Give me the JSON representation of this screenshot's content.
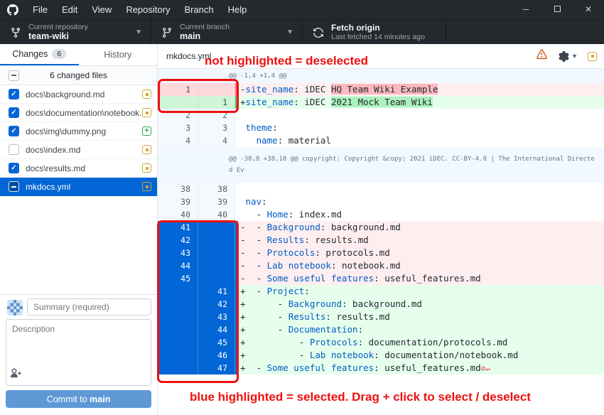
{
  "titlebar": {
    "menus": [
      "File",
      "Edit",
      "View",
      "Repository",
      "Branch",
      "Help"
    ],
    "window_controls": [
      "minimize",
      "maximize",
      "close"
    ]
  },
  "toolbar": {
    "repository": {
      "label": "Current repository",
      "value": "team-wiki"
    },
    "branch": {
      "label": "Current branch",
      "value": "main"
    },
    "fetch": {
      "title": "Fetch origin",
      "subtitle": "Last fetched 14 minutes ago"
    }
  },
  "sidebar": {
    "tabs": [
      {
        "label": "Changes",
        "badge": "6",
        "active": true
      },
      {
        "label": "History",
        "active": false
      }
    ],
    "files_header": {
      "label": "6 changed files",
      "checkbox": "partial"
    },
    "files": [
      {
        "name": "docs\\background.md",
        "checked": "checked",
        "status": "modified",
        "selected": false
      },
      {
        "name": "docs\\documentation\\notebook.md",
        "checked": "checked",
        "status": "modified",
        "selected": false
      },
      {
        "name": "docs\\img\\dummy.png",
        "checked": "checked",
        "status": "added",
        "selected": false
      },
      {
        "name": "docs\\index.md",
        "checked": "empty",
        "status": "modified",
        "selected": false
      },
      {
        "name": "docs\\results.md",
        "checked": "checked",
        "status": "modified",
        "selected": false
      },
      {
        "name": "mkdocs.yml",
        "checked": "partial",
        "status": "modified",
        "selected": true
      }
    ],
    "commit": {
      "summary_placeholder": "Summary (required)",
      "description_placeholder": "Description",
      "button_label": "Commit to ",
      "button_branch": "main"
    }
  },
  "diff": {
    "file_name": "mkdocs.yml",
    "rows": [
      {
        "k": "hunk",
        "text": "@@ -1,4 +1,4 @@"
      },
      {
        "k": "del",
        "old": "1",
        "new": "",
        "sel": false,
        "segs": [
          [
            "-",
            "p"
          ],
          [
            "site_name",
            "key"
          ],
          [
            ": iDEC ",
            "p"
          ],
          [
            "HQ Team Wiki Example",
            "hd"
          ]
        ]
      },
      {
        "k": "add",
        "old": "",
        "new": "1",
        "sel": false,
        "segs": [
          [
            "+",
            "p"
          ],
          [
            "site_name",
            "key"
          ],
          [
            ": iDEC ",
            "p"
          ],
          [
            "2021 Mock Team Wiki",
            "ha"
          ]
        ]
      },
      {
        "k": "ctx",
        "old": "2",
        "new": "2",
        "segs": [
          [
            " ",
            "p"
          ]
        ]
      },
      {
        "k": "ctx",
        "old": "3",
        "new": "3",
        "segs": [
          [
            " ",
            "p"
          ],
          [
            "theme",
            "key"
          ],
          [
            ":",
            "p"
          ]
        ]
      },
      {
        "k": "ctx",
        "old": "4",
        "new": "4",
        "segs": [
          [
            "   ",
            "p"
          ],
          [
            "name",
            "key"
          ],
          [
            ": material",
            "p"
          ]
        ]
      },
      {
        "k": "hunk",
        "tall": true,
        "text": "@@ -38,8 +38,10 @@ copyright: Copyright &copy; 2021 iDEC. CC-BY-4.0 | The International Directed Ev"
      },
      {
        "k": "ctx",
        "old": "38",
        "new": "38",
        "segs": [
          [
            " ",
            "p"
          ]
        ]
      },
      {
        "k": "ctx",
        "old": "39",
        "new": "39",
        "segs": [
          [
            " ",
            "p"
          ],
          [
            "nav",
            "key"
          ],
          [
            ":",
            "p"
          ]
        ]
      },
      {
        "k": "ctx",
        "old": "40",
        "new": "40",
        "segs": [
          [
            "   - ",
            "p"
          ],
          [
            "Home",
            "key"
          ],
          [
            ": index.md",
            "p"
          ]
        ]
      },
      {
        "k": "del",
        "old": "41",
        "new": "",
        "sel": true,
        "segs": [
          [
            "-  - ",
            "p"
          ],
          [
            "Background",
            "key"
          ],
          [
            ": background.md",
            "p"
          ]
        ]
      },
      {
        "k": "del",
        "old": "42",
        "new": "",
        "sel": true,
        "segs": [
          [
            "-  - ",
            "p"
          ],
          [
            "Results",
            "key"
          ],
          [
            ": results.md",
            "p"
          ]
        ]
      },
      {
        "k": "del",
        "old": "43",
        "new": "",
        "sel": true,
        "segs": [
          [
            "-  - ",
            "p"
          ],
          [
            "Protocols",
            "key"
          ],
          [
            ": protocols.md",
            "p"
          ]
        ]
      },
      {
        "k": "del",
        "old": "44",
        "new": "",
        "sel": true,
        "segs": [
          [
            "-  - ",
            "p"
          ],
          [
            "Lab notebook",
            "key"
          ],
          [
            ": notebook.md",
            "p"
          ]
        ]
      },
      {
        "k": "del",
        "old": "45",
        "new": "",
        "sel": true,
        "segs": [
          [
            "-  - ",
            "p"
          ],
          [
            "Some useful features",
            "key"
          ],
          [
            ": useful_features.md",
            "p"
          ]
        ]
      },
      {
        "k": "add",
        "old": "",
        "new": "41",
        "sel": true,
        "segs": [
          [
            "+  - ",
            "p"
          ],
          [
            "Project",
            "key"
          ],
          [
            ":",
            "p"
          ]
        ]
      },
      {
        "k": "add",
        "old": "",
        "new": "42",
        "sel": true,
        "segs": [
          [
            "+      - ",
            "p"
          ],
          [
            "Background",
            "key"
          ],
          [
            ": background.md",
            "p"
          ]
        ]
      },
      {
        "k": "add",
        "old": "",
        "new": "43",
        "sel": true,
        "segs": [
          [
            "+      - ",
            "p"
          ],
          [
            "Results",
            "key"
          ],
          [
            ": results.md",
            "p"
          ]
        ]
      },
      {
        "k": "add",
        "old": "",
        "new": "44",
        "sel": true,
        "segs": [
          [
            "+      - ",
            "p"
          ],
          [
            "Documentation",
            "key"
          ],
          [
            ":",
            "p"
          ]
        ]
      },
      {
        "k": "add",
        "old": "",
        "new": "45",
        "sel": true,
        "segs": [
          [
            "+          - ",
            "p"
          ],
          [
            "Protocols",
            "key"
          ],
          [
            ": documentation/protocols.md",
            "p"
          ]
        ]
      },
      {
        "k": "add",
        "old": "",
        "new": "46",
        "sel": true,
        "segs": [
          [
            "+          - ",
            "p"
          ],
          [
            "Lab notebook",
            "key"
          ],
          [
            ": documentation/notebook.md",
            "p"
          ]
        ]
      },
      {
        "k": "add",
        "old": "",
        "new": "47",
        "sel": true,
        "segs": [
          [
            "+  - ",
            "p"
          ],
          [
            "Some useful features",
            "key"
          ],
          [
            ": useful_features.md",
            "p"
          ],
          [
            "⊘↵",
            "eol"
          ]
        ]
      }
    ]
  },
  "annotations": {
    "top": "not highlighted = deselected",
    "bottom": "blue highlighted = selected. Drag + click to select / deselect",
    "color": "#ee0f0f"
  },
  "colors": {
    "titlebar_bg": "#24292e",
    "accent_blue": "#0366d6",
    "selected_row": "#0366d6",
    "removed_bg": "#ffeef0",
    "removed_gutter": "#ffd8dc",
    "removed_word": "#fdb8c0",
    "added_bg": "#e6ffed",
    "added_gutter": "#cdf5d6",
    "added_word": "#acf2bd",
    "hunk_bg": "#f1f8ff",
    "modified_icon": "#d4a72c",
    "added_icon": "#28a745",
    "warning_icon": "#bf5b16",
    "commit_button": "#5e99d6",
    "yaml_key": "#005cc5"
  }
}
